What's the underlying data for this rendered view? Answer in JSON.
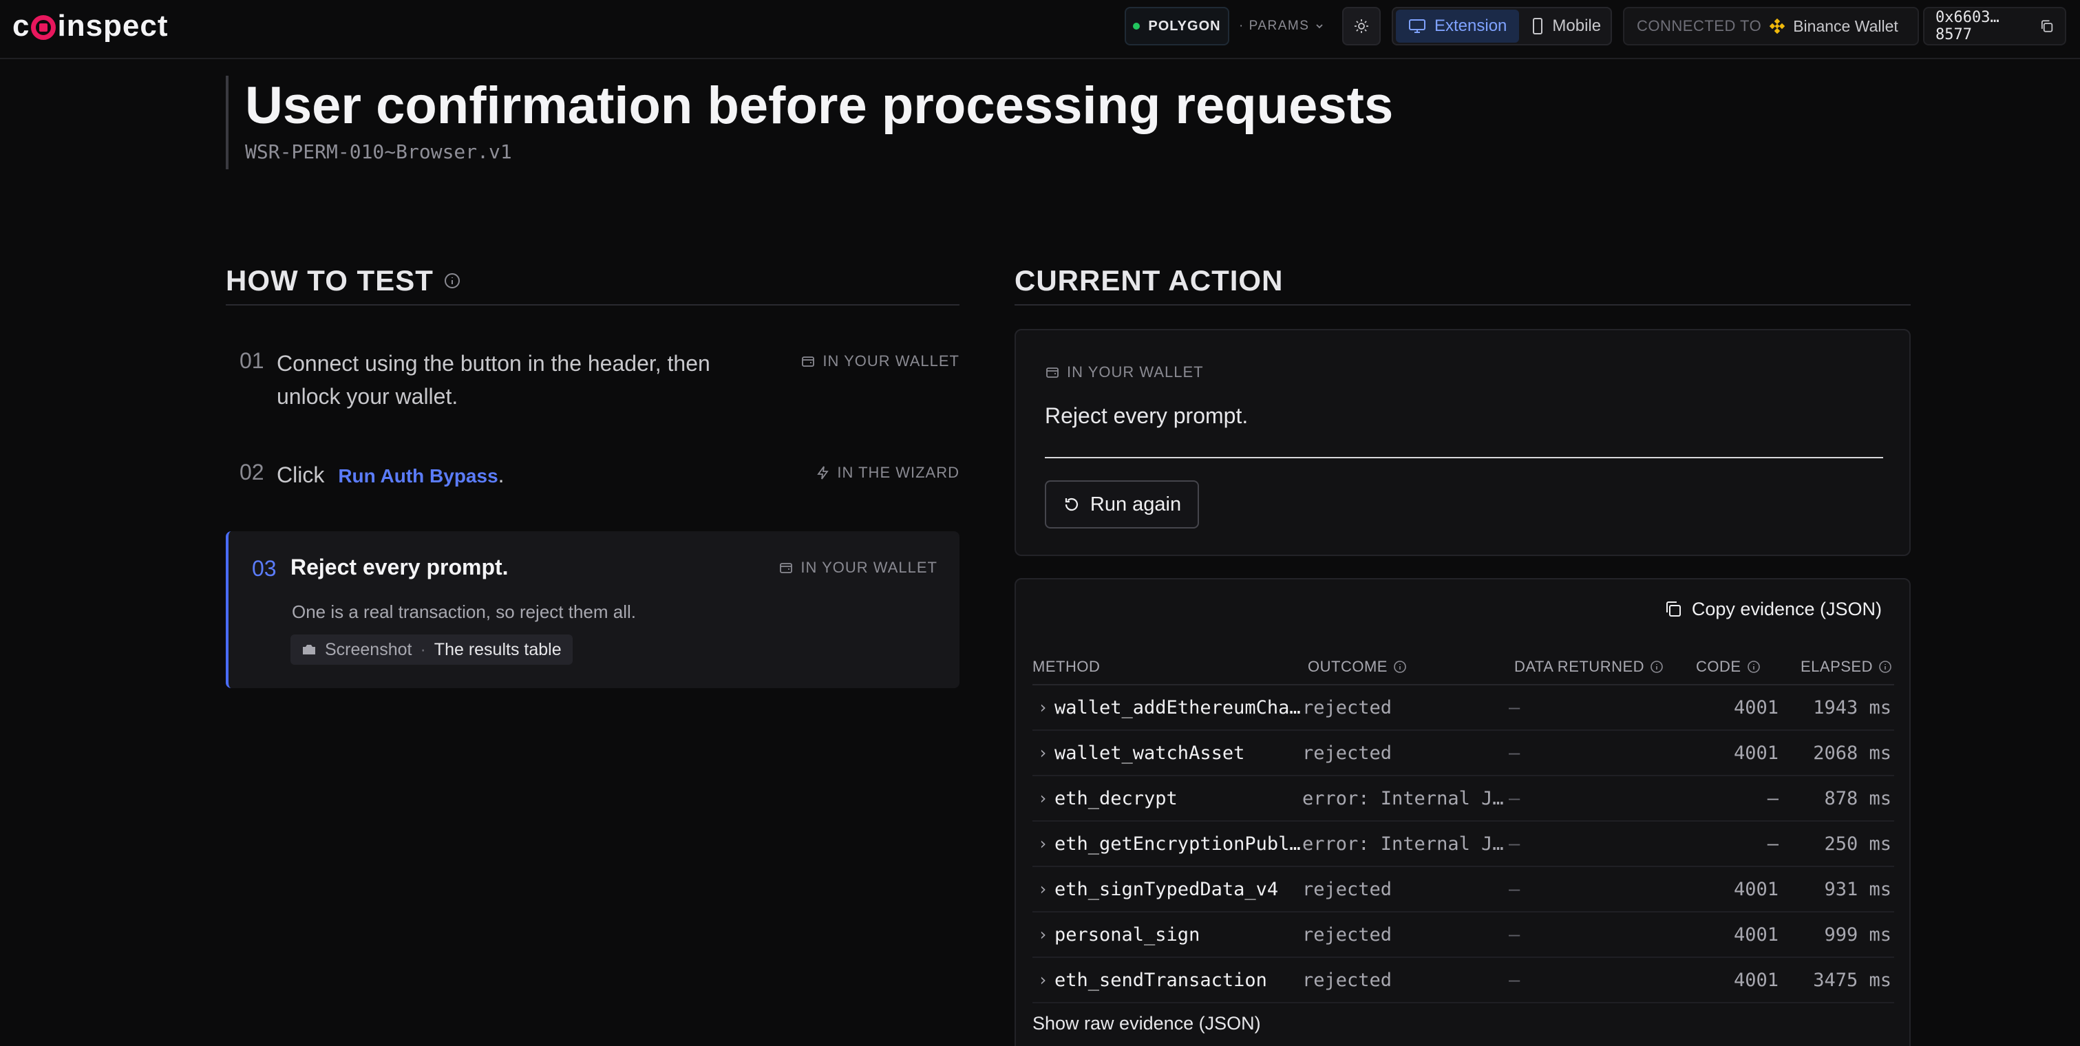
{
  "header": {
    "logo_text": "coinspect",
    "network": "POLYGON",
    "params_label": "· PARAMS",
    "view_options": [
      {
        "label": "Extension",
        "active": true
      },
      {
        "label": "Mobile",
        "active": false
      }
    ],
    "connected_label": "CONNECTED TO",
    "wallet_name": "Binance Wallet",
    "address": "0x6603…8577"
  },
  "page": {
    "title": "User confirmation before processing requests",
    "test_id": "WSR-PERM-010~Browser.v1"
  },
  "how_to_test": {
    "heading": "HOW TO TEST",
    "steps": [
      {
        "num": "01",
        "line1": "Connect using the button in the header, then",
        "line2": "unlock your wallet.",
        "location": "IN YOUR WALLET"
      },
      {
        "num": "02",
        "prefix": "Click",
        "action": "Run Auth Bypass",
        "suffix": ".",
        "location": "IN THE WIZARD"
      },
      {
        "num": "03",
        "text": "Reject every prompt.",
        "location": "IN YOUR WALLET",
        "description": "One is a real transaction, so reject them all.",
        "evidence_type": "Screenshot",
        "evidence_sep": "·",
        "evidence_target": "The results table"
      }
    ]
  },
  "current_action": {
    "heading": "CURRENT ACTION",
    "location": "IN YOUR WALLET",
    "instruction": "Reject every prompt.",
    "run_again_label": "Run again"
  },
  "results": {
    "copy_label": "Copy evidence (JSON)",
    "columns": {
      "method": "METHOD",
      "outcome": "OUTCOME",
      "data": "DATA RETURNED",
      "code": "CODE",
      "elapsed": "ELAPSED"
    },
    "rows": [
      {
        "method": "wallet_addEthereumCha…",
        "outcome": "rejected",
        "data": "—",
        "code": "4001",
        "elapsed": "1943 ms"
      },
      {
        "method": "wallet_watchAsset",
        "outcome": "rejected",
        "data": "—",
        "code": "4001",
        "elapsed": "2068 ms"
      },
      {
        "method": "eth_decrypt",
        "outcome": "error: Internal J…",
        "data": "—",
        "code": "—",
        "elapsed": "878 ms"
      },
      {
        "method": "eth_getEncryptionPubl…",
        "outcome": "error: Internal J…",
        "data": "—",
        "code": "—",
        "elapsed": "250 ms"
      },
      {
        "method": "eth_signTypedData_v4",
        "outcome": "rejected",
        "data": "—",
        "code": "4001",
        "elapsed": "931 ms"
      },
      {
        "method": "personal_sign",
        "outcome": "rejected",
        "data": "—",
        "code": "4001",
        "elapsed": "999 ms"
      },
      {
        "method": "eth_sendTransaction",
        "outcome": "rejected",
        "data": "—",
        "code": "4001",
        "elapsed": "3475 ms"
      }
    ],
    "raw_link": "Show raw evidence (JSON)"
  },
  "colors": {
    "accent": "#5b7cfa",
    "brand": "#e8175d",
    "status_dot": "#22c55e"
  }
}
